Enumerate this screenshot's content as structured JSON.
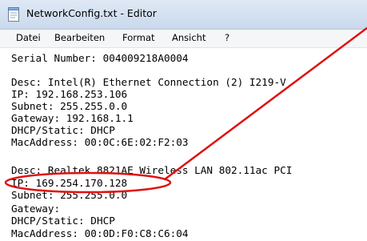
{
  "window": {
    "title": "NetworkConfig.txt - Editor",
    "icon": "notepad-icon"
  },
  "menu": {
    "items": [
      "Datei",
      "Bearbeiten",
      "Format",
      "Ansicht",
      "?"
    ]
  },
  "editor": {
    "lines": [
      "Serial Number: 004009218A0004",
      "",
      "Desc: Intel(R) Ethernet Connection (2) I219-V",
      "IP: 192.168.253.106",
      "Subnet: 255.255.0.0",
      "Gateway: 192.168.1.1",
      "DHCP/Static: DHCP",
      "MacAddress: 00:0C:6E:02:F2:03",
      "",
      "Desc: Realtek 8821AE Wireless LAN 802.11ac PCI",
      "IP: 169.254.170.128",
      "Subnet: 255.255.0.0",
      "Gateway:",
      "DHCP/Static: DHCP",
      "MacAddress: 00:0D:F0:C8:C6:04"
    ]
  },
  "annotation": {
    "color": "#e01010",
    "shape": "ellipse-with-arrow-line",
    "highlight": "IP: 169.254.170.128"
  }
}
